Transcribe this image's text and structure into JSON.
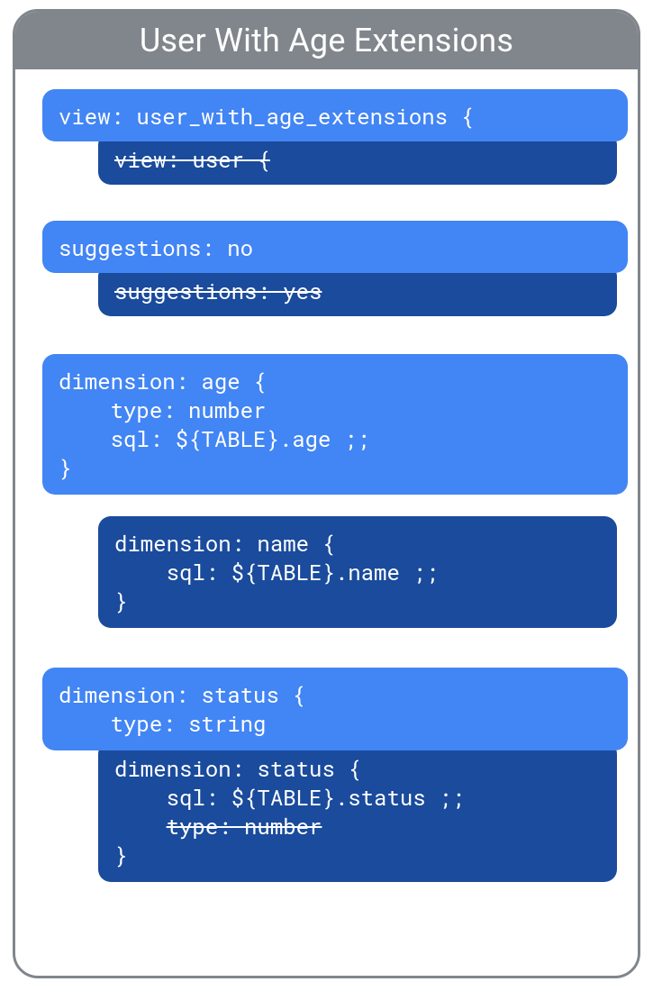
{
  "title": "User With Age Extensions",
  "blocks": {
    "view_light": "view: user_with_age_extensions {",
    "view_dark_strike": "view: user {",
    "sugg_light": "suggestions: no",
    "sugg_dark_strike": "suggestions: yes",
    "age_light": "dimension: age {\n    type: number\n    sql: ${TABLE}.age ;;\n}",
    "name_dark": "dimension: name {\n    sql: ${TABLE}.name ;;\n}",
    "status_light": "dimension: status {\n    type: string",
    "status_dark_l1": "dimension: status {",
    "status_dark_l2": "    sql: ${TABLE}.status ;;",
    "status_dark_l3_strike": "type: number",
    "status_dark_l4": "}"
  }
}
